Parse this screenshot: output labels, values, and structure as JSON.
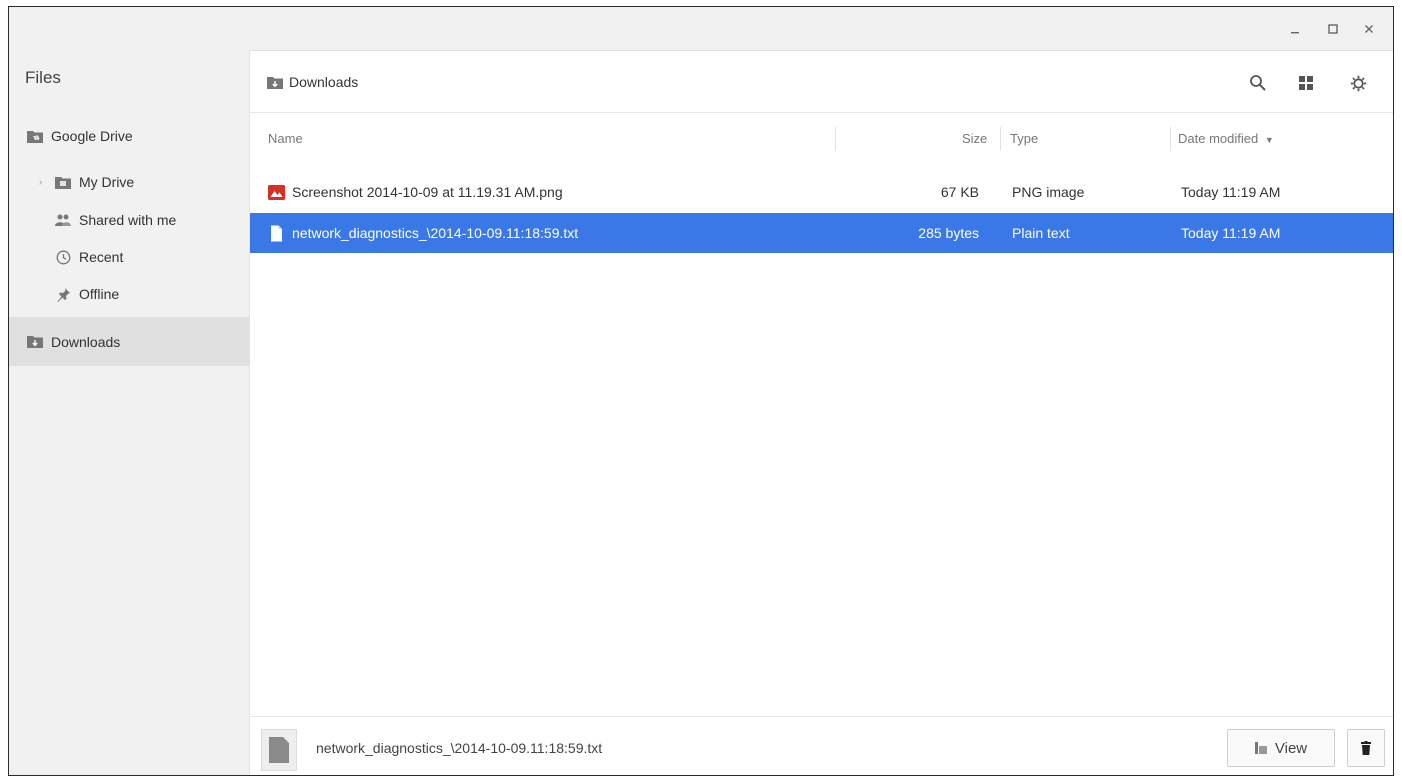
{
  "window": {
    "minimize": "_",
    "maximize": "□",
    "close": "×"
  },
  "sidebar": {
    "title": "Files",
    "items": [
      {
        "label": "Google Drive",
        "icon": "drive-folder-icon"
      },
      {
        "label": "My Drive",
        "icon": "folder-icon"
      },
      {
        "label": "Shared with me",
        "icon": "people-icon"
      },
      {
        "label": "Recent",
        "icon": "clock-icon"
      },
      {
        "label": "Offline",
        "icon": "pin-icon"
      },
      {
        "label": "Downloads",
        "icon": "download-folder-icon"
      }
    ]
  },
  "toolbar": {
    "breadcrumb": "Downloads"
  },
  "columns": {
    "name": "Name",
    "size": "Size",
    "type": "Type",
    "date": "Date modified"
  },
  "files": [
    {
      "name": "Screenshot 2014-10-09 at 11.19.31 AM.png",
      "size": "67 KB",
      "type": "PNG image",
      "date": "Today 11:19 AM",
      "selected": false
    },
    {
      "name": "network_diagnostics_\\2014-10-09.11:18:59.txt",
      "size": "285 bytes",
      "type": "Plain text",
      "date": "Today 11:19 AM",
      "selected": true
    }
  ],
  "footer": {
    "filename": "network_diagnostics_\\2014-10-09.11:18:59.txt",
    "view_label": "View"
  },
  "colors": {
    "selection": "#3b78e7",
    "sidebar_bg": "#f1f1f1",
    "image_icon": "#d93025"
  }
}
